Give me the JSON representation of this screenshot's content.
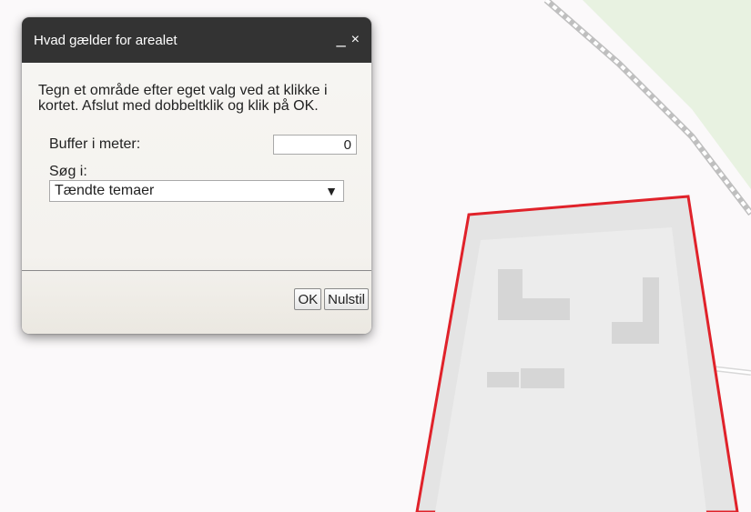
{
  "dialog": {
    "title": "Hvad gælder for arealet",
    "minimize_glyph": "_",
    "close_glyph": "×",
    "description": "Tegn et område efter eget valg ved at klikke i kortet. Afslut med dobbeltklik og klik på OK.",
    "buffer_label": "Buffer i meter:",
    "buffer_value": "0",
    "search_label": "Søg i:",
    "search_selected": "Tændte temaer",
    "select_arrow": "▼",
    "ok_label": "OK",
    "reset_label": "Nulstil"
  },
  "map": {
    "colors": {
      "background": "#fbf9fa",
      "park": "#e8f2e1",
      "selection_outline": "#e0222a",
      "selection_fill": "#e4e4e4",
      "building": "#d6d6d6",
      "railway": "#bcbcbc"
    }
  }
}
